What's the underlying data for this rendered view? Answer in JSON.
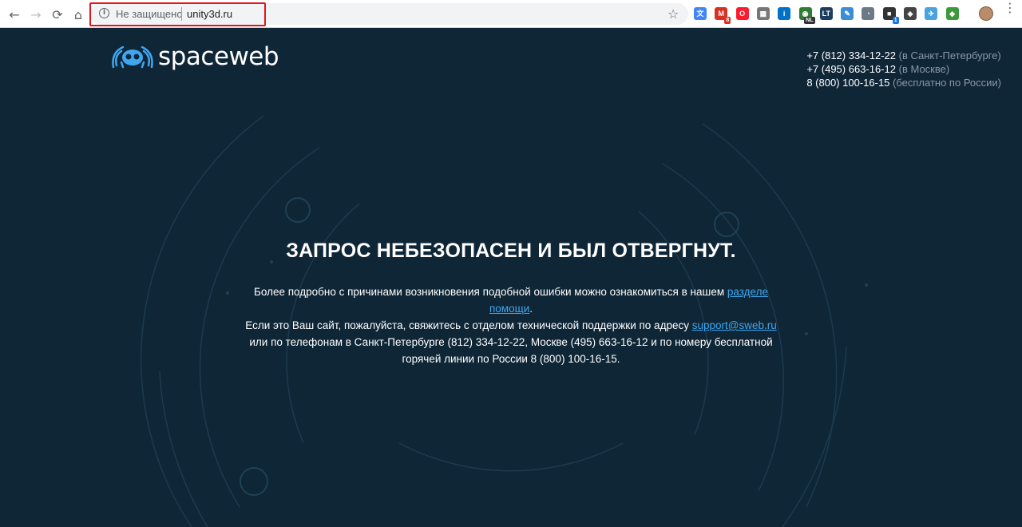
{
  "browser": {
    "back_icon": "←",
    "forward_icon": "→",
    "reload_icon": "⟳",
    "home_icon": "⌂",
    "not_secure": "Не защищено",
    "url": "unity3d.ru",
    "star_icon": "☆",
    "menu_icon": "⋮",
    "extensions": [
      {
        "name": "translate-extension-icon",
        "color": "#4285f4",
        "glyph": "文",
        "badge": ""
      },
      {
        "name": "gmail-extension-icon",
        "color": "#d93025",
        "glyph": "M",
        "badge": "8"
      },
      {
        "name": "opera-extension-icon",
        "color": "#ff1b2d",
        "glyph": "O",
        "badge": ""
      },
      {
        "name": "grid-extension-icon",
        "color": "#777777",
        "glyph": "▦",
        "badge": ""
      },
      {
        "name": "intel-extension-icon",
        "color": "#0071c5",
        "glyph": "i",
        "badge": ""
      },
      {
        "name": "globe-nl-extension-icon",
        "color": "#2e7d32",
        "glyph": "◉",
        "badge": "NL"
      },
      {
        "name": "lt-extension-icon",
        "color": "#1c3f60",
        "glyph": "LT",
        "badge": ""
      },
      {
        "name": "pen-extension-icon",
        "color": "#3b8dd6",
        "glyph": "✎",
        "badge": ""
      },
      {
        "name": "speed-extension-icon",
        "color": "#6b7a86",
        "glyph": "◔",
        "badge": ""
      },
      {
        "name": "cube-extension-icon",
        "color": "#333333",
        "glyph": "■",
        "badge": "1"
      },
      {
        "name": "shield-extension-icon",
        "color": "#444444",
        "glyph": "◈",
        "badge": ""
      },
      {
        "name": "bird-extension-icon",
        "color": "#4aa3df",
        "glyph": "✈",
        "badge": ""
      },
      {
        "name": "diamond-extension-icon",
        "color": "#3c9a3c",
        "glyph": "◆",
        "badge": ""
      }
    ]
  },
  "page": {
    "logo_text": "spaceweb",
    "phones": [
      {
        "number": "+7 (812) 334-12-22",
        "note": "(в Санкт-Петербурге)"
      },
      {
        "number": "+7 (495) 663-16-12",
        "note": "(в Москве)"
      },
      {
        "number": "8 (800) 100-16-15",
        "note": "(бесплатно по России)"
      }
    ],
    "headline": "ЗАПРОС НЕБЕЗОПАСЕН И БЫЛ ОТВЕРГНУТ.",
    "para1_text": "Более подробно с причинами возникновения подобной ошибки можно ознакомиться в нашем ",
    "para1_link": "разделе помощи",
    "para1_end": ".",
    "para2_text": "Если это Ваш сайт, пожалуйста, свяжитесь с отделом технической поддержки по адресу ",
    "para2_link": "support@sweb.ru",
    "para2_end": " или по телефонам в Санкт-Петербурге (812) 334-12-22, Москве (495) 663-16-12 и по номеру бесплатной горячей линии по России 8 (800) 100-16-15."
  },
  "colors": {
    "page_bg": "#0f2637",
    "link": "#3fa7f0",
    "highlight": "#e0161b"
  }
}
